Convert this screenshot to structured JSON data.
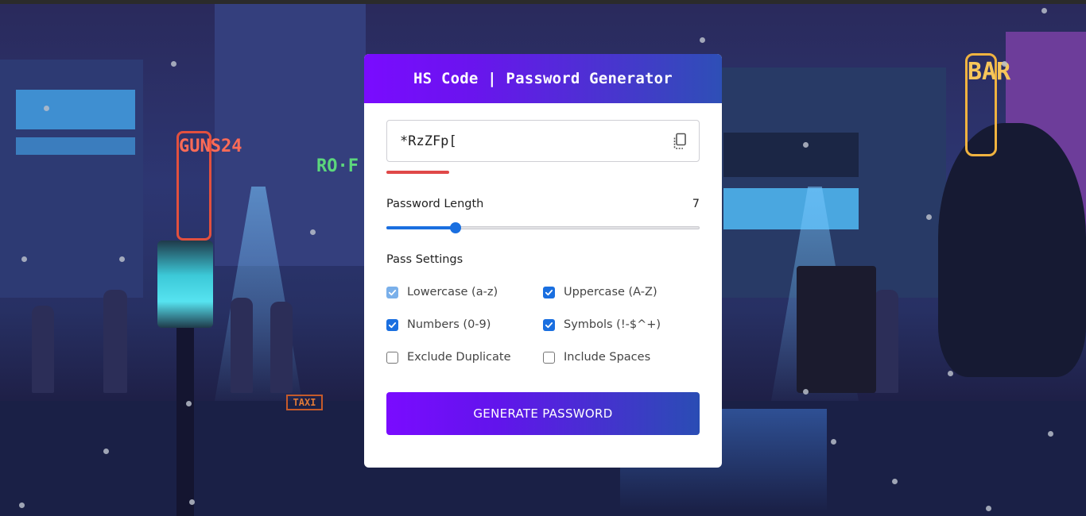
{
  "card": {
    "title": "HS Code | Password Generator",
    "password_value": "*RzZFp[",
    "copy_icon": "copy-icon",
    "strength_color": "#e04848",
    "length_label": "Password Length",
    "length_value": "7",
    "length_slider_fraction": 0.22,
    "settings_label": "Pass Settings",
    "options": [
      {
        "label": "Lowercase (a-z)",
        "checked": true,
        "disabled": true
      },
      {
        "label": "Uppercase (A-Z)",
        "checked": true,
        "disabled": false
      },
      {
        "label": "Numbers (0-9)",
        "checked": true,
        "disabled": false
      },
      {
        "label": "Symbols (!-$^+)",
        "checked": true,
        "disabled": false
      },
      {
        "label": "Exclude Duplicate",
        "checked": false,
        "disabled": false
      },
      {
        "label": "Include Spaces",
        "checked": false,
        "disabled": false
      }
    ],
    "generate_label": "GENERATE PASSWORD",
    "accent_color": "#7a0bff",
    "accent_color_end": "#2e4fb6",
    "check_color": "#1a6fe0"
  },
  "background": {
    "sign_guns": "GUNS24",
    "sign_bar": "BAR",
    "sign_ro": "RO·F",
    "sign_taxi": "TAXI"
  }
}
